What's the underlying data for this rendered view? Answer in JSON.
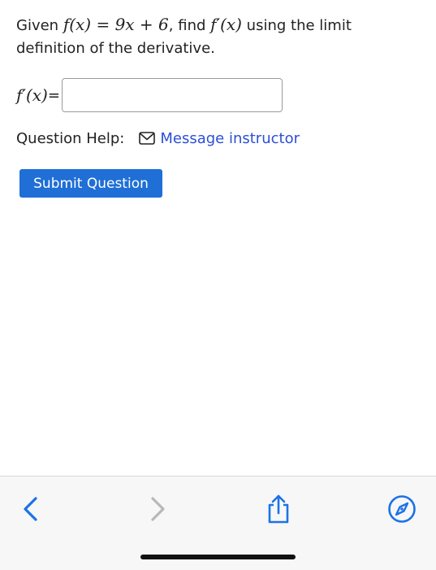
{
  "question": {
    "prefix": "Given ",
    "function_def": "f(x) = 9x + 6",
    "middle": ", find ",
    "target": "f′(x)",
    "suffix": " using the limit definition of the derivative."
  },
  "answer": {
    "label": "f′(x)",
    "label_suffix": "=",
    "value": "",
    "placeholder": ""
  },
  "help": {
    "label": "Question Help:",
    "link_text": "Message instructor"
  },
  "submit": {
    "label": "Submit Question"
  },
  "toolbar": {
    "items": [
      {
        "name": "back",
        "icon": "chevron-left-icon",
        "enabled": true
      },
      {
        "name": "forward",
        "icon": "chevron-right-icon",
        "enabled": false
      },
      {
        "name": "share",
        "icon": "share-icon",
        "enabled": true
      },
      {
        "name": "safari",
        "icon": "compass-icon",
        "enabled": true
      }
    ]
  },
  "colors": {
    "accent": "#1f6fd6",
    "link": "#2c4fd6",
    "ios_blue": "#1a73e8",
    "disabled": "#b8b8b8"
  }
}
